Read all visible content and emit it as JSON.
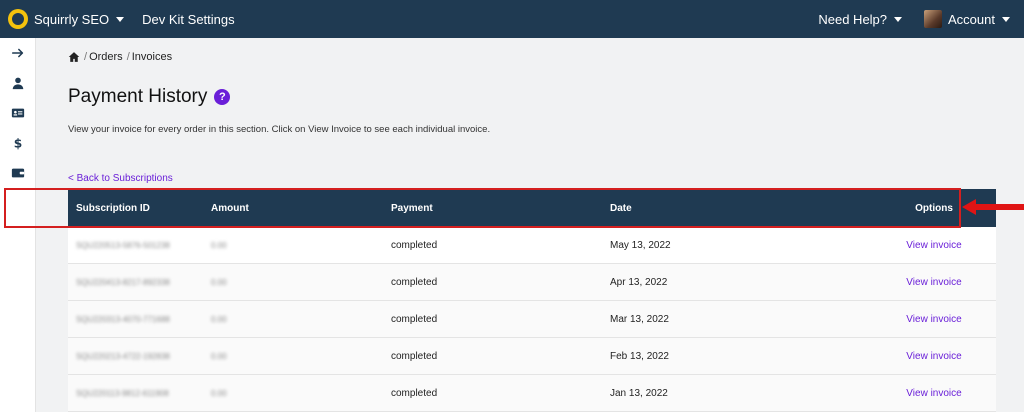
{
  "topbar": {
    "brand": "Squirrly SEO",
    "dev_kit": "Dev Kit Settings",
    "help": "Need Help?",
    "account": "Account"
  },
  "breadcrumb": [
    "Orders",
    "Invoices"
  ],
  "page": {
    "title": "Payment History",
    "help_badge": "?",
    "description": "View your invoice for every order in this section. Click on View Invoice to see each individual invoice.",
    "back_link": "< Back to Subscriptions"
  },
  "table": {
    "headers": [
      "Subscription ID",
      "Amount",
      "Payment",
      "Date",
      "Options"
    ],
    "rows": [
      {
        "id": "SQU220513-5876-501238",
        "amount": "0.00",
        "payment": "completed",
        "date": "May 13, 2022",
        "option": "View invoice"
      },
      {
        "id": "SQU220413-8217-892338",
        "amount": "0.00",
        "payment": "completed",
        "date": "Apr 13, 2022",
        "option": "View invoice"
      },
      {
        "id": "SQU220313-4070-771688",
        "amount": "0.00",
        "payment": "completed",
        "date": "Mar 13, 2022",
        "option": "View invoice"
      },
      {
        "id": "SQU220213-4722-192838",
        "amount": "0.00",
        "payment": "completed",
        "date": "Feb 13, 2022",
        "option": "View invoice"
      },
      {
        "id": "SQU220113-9812-611908",
        "amount": "0.00",
        "payment": "completed",
        "date": "Jan 13, 2022",
        "option": "View invoice"
      }
    ]
  },
  "colors": {
    "header_bg": "#1f3a52",
    "accent": "#6a1fd8",
    "highlight": "#d41f1f"
  },
  "icons": {
    "sidebar": [
      "arrow-right-icon",
      "user-icon",
      "id-card-icon",
      "dollar-icon",
      "wallet-icon"
    ],
    "breadcrumb": "home-icon"
  }
}
